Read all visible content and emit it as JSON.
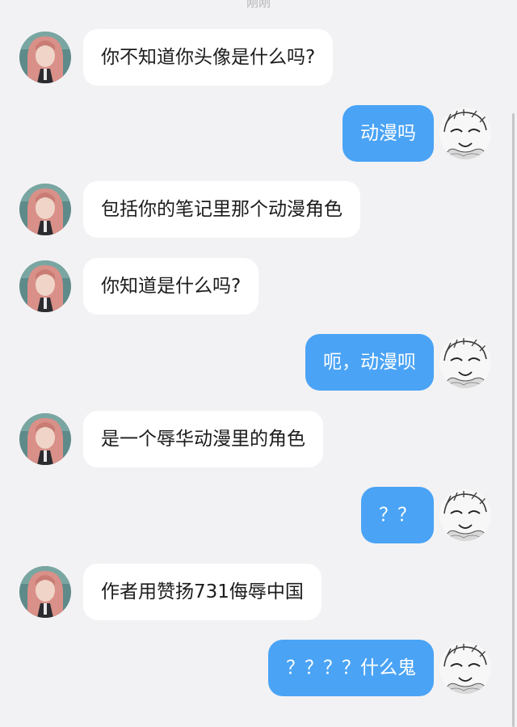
{
  "timestamp": "刚刚",
  "colors": {
    "background": "#f2f2f4",
    "incoming_bubble": "#ffffff",
    "outgoing_bubble": "#4aa3f5",
    "incoming_text": "#1c1c1e",
    "outgoing_text": "#ffffff"
  },
  "messages": [
    {
      "side": "incoming",
      "text": "你不知道你头像是什么吗?"
    },
    {
      "side": "outgoing",
      "text": "动漫吗"
    },
    {
      "side": "incoming",
      "text": "包括你的笔记里那个动漫角色"
    },
    {
      "side": "incoming",
      "text": "你知道是什么吗?"
    },
    {
      "side": "outgoing",
      "text": "呃，动漫呗"
    },
    {
      "side": "incoming",
      "text": "是一个辱华动漫里的角色"
    },
    {
      "side": "outgoing",
      "text": "？？"
    },
    {
      "side": "incoming",
      "text": "作者用赞扬731侮辱中国"
    },
    {
      "side": "outgoing",
      "text": "？？？？什么鬼"
    }
  ]
}
